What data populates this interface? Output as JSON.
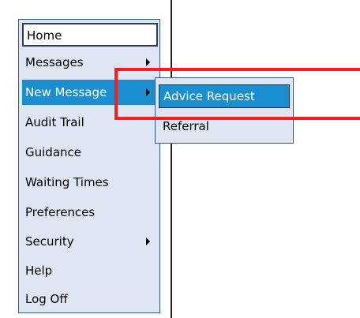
{
  "menu": {
    "items": [
      {
        "label": "Home",
        "has_submenu": false
      },
      {
        "label": "Messages",
        "has_submenu": true
      },
      {
        "label": "New Message",
        "has_submenu": true
      },
      {
        "label": "Audit Trail",
        "has_submenu": false
      },
      {
        "label": "Guidance",
        "has_submenu": false
      },
      {
        "label": "Waiting Times",
        "has_submenu": false
      },
      {
        "label": "Preferences",
        "has_submenu": false
      },
      {
        "label": "Security",
        "has_submenu": true
      },
      {
        "label": "Help",
        "has_submenu": false
      },
      {
        "label": "Log Off",
        "has_submenu": false
      }
    ]
  },
  "submenu": {
    "items": [
      {
        "label": "Advice Request"
      },
      {
        "label": "Referral"
      }
    ]
  },
  "colors": {
    "menu_bg": "#dde6f2",
    "menu_border": "#2f57a0",
    "selected_bg": "#1a8ecf",
    "highlight": "#ff1b1b"
  }
}
